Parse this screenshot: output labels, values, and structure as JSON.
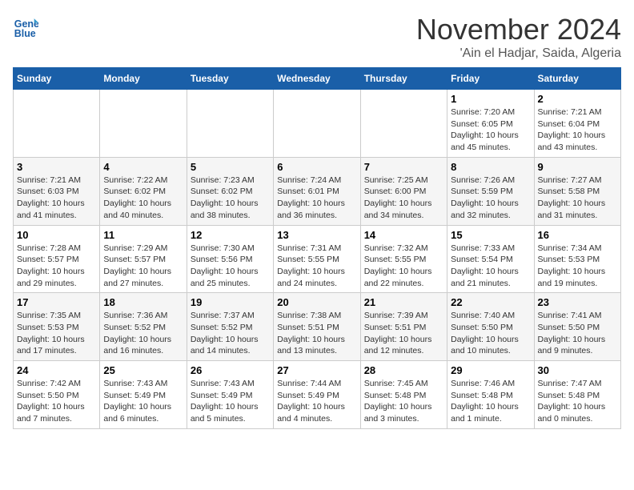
{
  "header": {
    "logo_line1": "General",
    "logo_line2": "Blue",
    "month": "November 2024",
    "location": "'Ain el Hadjar, Saida, Algeria"
  },
  "days_of_week": [
    "Sunday",
    "Monday",
    "Tuesday",
    "Wednesday",
    "Thursday",
    "Friday",
    "Saturday"
  ],
  "weeks": [
    [
      {
        "day": "",
        "info": ""
      },
      {
        "day": "",
        "info": ""
      },
      {
        "day": "",
        "info": ""
      },
      {
        "day": "",
        "info": ""
      },
      {
        "day": "",
        "info": ""
      },
      {
        "day": "1",
        "info": "Sunrise: 7:20 AM\nSunset: 6:05 PM\nDaylight: 10 hours\nand 45 minutes."
      },
      {
        "day": "2",
        "info": "Sunrise: 7:21 AM\nSunset: 6:04 PM\nDaylight: 10 hours\nand 43 minutes."
      }
    ],
    [
      {
        "day": "3",
        "info": "Sunrise: 7:21 AM\nSunset: 6:03 PM\nDaylight: 10 hours\nand 41 minutes."
      },
      {
        "day": "4",
        "info": "Sunrise: 7:22 AM\nSunset: 6:02 PM\nDaylight: 10 hours\nand 40 minutes."
      },
      {
        "day": "5",
        "info": "Sunrise: 7:23 AM\nSunset: 6:02 PM\nDaylight: 10 hours\nand 38 minutes."
      },
      {
        "day": "6",
        "info": "Sunrise: 7:24 AM\nSunset: 6:01 PM\nDaylight: 10 hours\nand 36 minutes."
      },
      {
        "day": "7",
        "info": "Sunrise: 7:25 AM\nSunset: 6:00 PM\nDaylight: 10 hours\nand 34 minutes."
      },
      {
        "day": "8",
        "info": "Sunrise: 7:26 AM\nSunset: 5:59 PM\nDaylight: 10 hours\nand 32 minutes."
      },
      {
        "day": "9",
        "info": "Sunrise: 7:27 AM\nSunset: 5:58 PM\nDaylight: 10 hours\nand 31 minutes."
      }
    ],
    [
      {
        "day": "10",
        "info": "Sunrise: 7:28 AM\nSunset: 5:57 PM\nDaylight: 10 hours\nand 29 minutes."
      },
      {
        "day": "11",
        "info": "Sunrise: 7:29 AM\nSunset: 5:57 PM\nDaylight: 10 hours\nand 27 minutes."
      },
      {
        "day": "12",
        "info": "Sunrise: 7:30 AM\nSunset: 5:56 PM\nDaylight: 10 hours\nand 25 minutes."
      },
      {
        "day": "13",
        "info": "Sunrise: 7:31 AM\nSunset: 5:55 PM\nDaylight: 10 hours\nand 24 minutes."
      },
      {
        "day": "14",
        "info": "Sunrise: 7:32 AM\nSunset: 5:55 PM\nDaylight: 10 hours\nand 22 minutes."
      },
      {
        "day": "15",
        "info": "Sunrise: 7:33 AM\nSunset: 5:54 PM\nDaylight: 10 hours\nand 21 minutes."
      },
      {
        "day": "16",
        "info": "Sunrise: 7:34 AM\nSunset: 5:53 PM\nDaylight: 10 hours\nand 19 minutes."
      }
    ],
    [
      {
        "day": "17",
        "info": "Sunrise: 7:35 AM\nSunset: 5:53 PM\nDaylight: 10 hours\nand 17 minutes."
      },
      {
        "day": "18",
        "info": "Sunrise: 7:36 AM\nSunset: 5:52 PM\nDaylight: 10 hours\nand 16 minutes."
      },
      {
        "day": "19",
        "info": "Sunrise: 7:37 AM\nSunset: 5:52 PM\nDaylight: 10 hours\nand 14 minutes."
      },
      {
        "day": "20",
        "info": "Sunrise: 7:38 AM\nSunset: 5:51 PM\nDaylight: 10 hours\nand 13 minutes."
      },
      {
        "day": "21",
        "info": "Sunrise: 7:39 AM\nSunset: 5:51 PM\nDaylight: 10 hours\nand 12 minutes."
      },
      {
        "day": "22",
        "info": "Sunrise: 7:40 AM\nSunset: 5:50 PM\nDaylight: 10 hours\nand 10 minutes."
      },
      {
        "day": "23",
        "info": "Sunrise: 7:41 AM\nSunset: 5:50 PM\nDaylight: 10 hours\nand 9 minutes."
      }
    ],
    [
      {
        "day": "24",
        "info": "Sunrise: 7:42 AM\nSunset: 5:50 PM\nDaylight: 10 hours\nand 7 minutes."
      },
      {
        "day": "25",
        "info": "Sunrise: 7:43 AM\nSunset: 5:49 PM\nDaylight: 10 hours\nand 6 minutes."
      },
      {
        "day": "26",
        "info": "Sunrise: 7:43 AM\nSunset: 5:49 PM\nDaylight: 10 hours\nand 5 minutes."
      },
      {
        "day": "27",
        "info": "Sunrise: 7:44 AM\nSunset: 5:49 PM\nDaylight: 10 hours\nand 4 minutes."
      },
      {
        "day": "28",
        "info": "Sunrise: 7:45 AM\nSunset: 5:48 PM\nDaylight: 10 hours\nand 3 minutes."
      },
      {
        "day": "29",
        "info": "Sunrise: 7:46 AM\nSunset: 5:48 PM\nDaylight: 10 hours\nand 1 minute."
      },
      {
        "day": "30",
        "info": "Sunrise: 7:47 AM\nSunset: 5:48 PM\nDaylight: 10 hours\nand 0 minutes."
      }
    ]
  ]
}
